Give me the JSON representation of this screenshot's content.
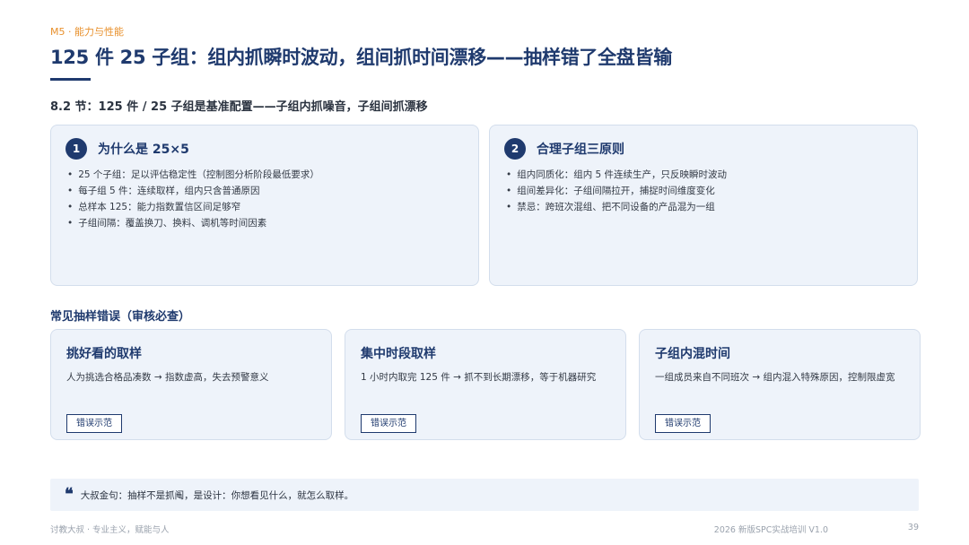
{
  "header": {
    "module_tag": "M5 · 能力与性能",
    "title": "125 件 25 子组：组内抓瞬时波动，组间抓时间漂移——抽样错了全盘皆输",
    "subtitle": "8.2 节：125 件 / 25 子组是基准配置——子组内抓噪音，子组间抓漂移"
  },
  "panels": [
    {
      "number": "1",
      "title": "为什么是 25×5",
      "bullets": [
        "25 个子组：足以评估稳定性（控制图分析阶段最低要求）",
        "每子组 5 件：连续取样，组内只含普通原因",
        "总样本 125：能力指数置信区间足够窄",
        "子组间隔：覆盖换刀、换料、调机等时间因素"
      ]
    },
    {
      "number": "2",
      "title": "合理子组三原则",
      "bullets": [
        "组内同质化：组内 5 件连续生产，只反映瞬时波动",
        "组间差异化：子组间隔拉开，捕捉时间维度变化",
        "禁忌：跨班次混组、把不同设备的产品混为一组"
      ]
    }
  ],
  "errors_section": {
    "label": "常见抽样错误（审核必查）",
    "cards": [
      {
        "title": "挑好看的取样",
        "desc": "人为挑选合格品凑数 → 指数虚高，失去预警意义",
        "button": "错误示范"
      },
      {
        "title": "集中时段取样",
        "desc": "1 小时内取完 125 件 → 抓不到长期漂移，等于机器研究",
        "button": "错误示范"
      },
      {
        "title": "子组内混时间",
        "desc": "一组成员来自不同班次 → 组内混入特殊原因，控制限虚宽",
        "button": "错误示范"
      }
    ]
  },
  "quote": {
    "icon": "quote-mark-icon",
    "text": "大叔金句：抽样不是抓阄，是设计：你想看见什么，就怎么取样。"
  },
  "footer": {
    "left": "讨教大叔 · 专业主义，赋能与人",
    "right": "2026 新版SPC实战培训 V1.0",
    "page": "39"
  },
  "colors": {
    "accent": "#e8902c",
    "primary": "#1f3a6e",
    "panel_bg": "#eef3fa"
  }
}
